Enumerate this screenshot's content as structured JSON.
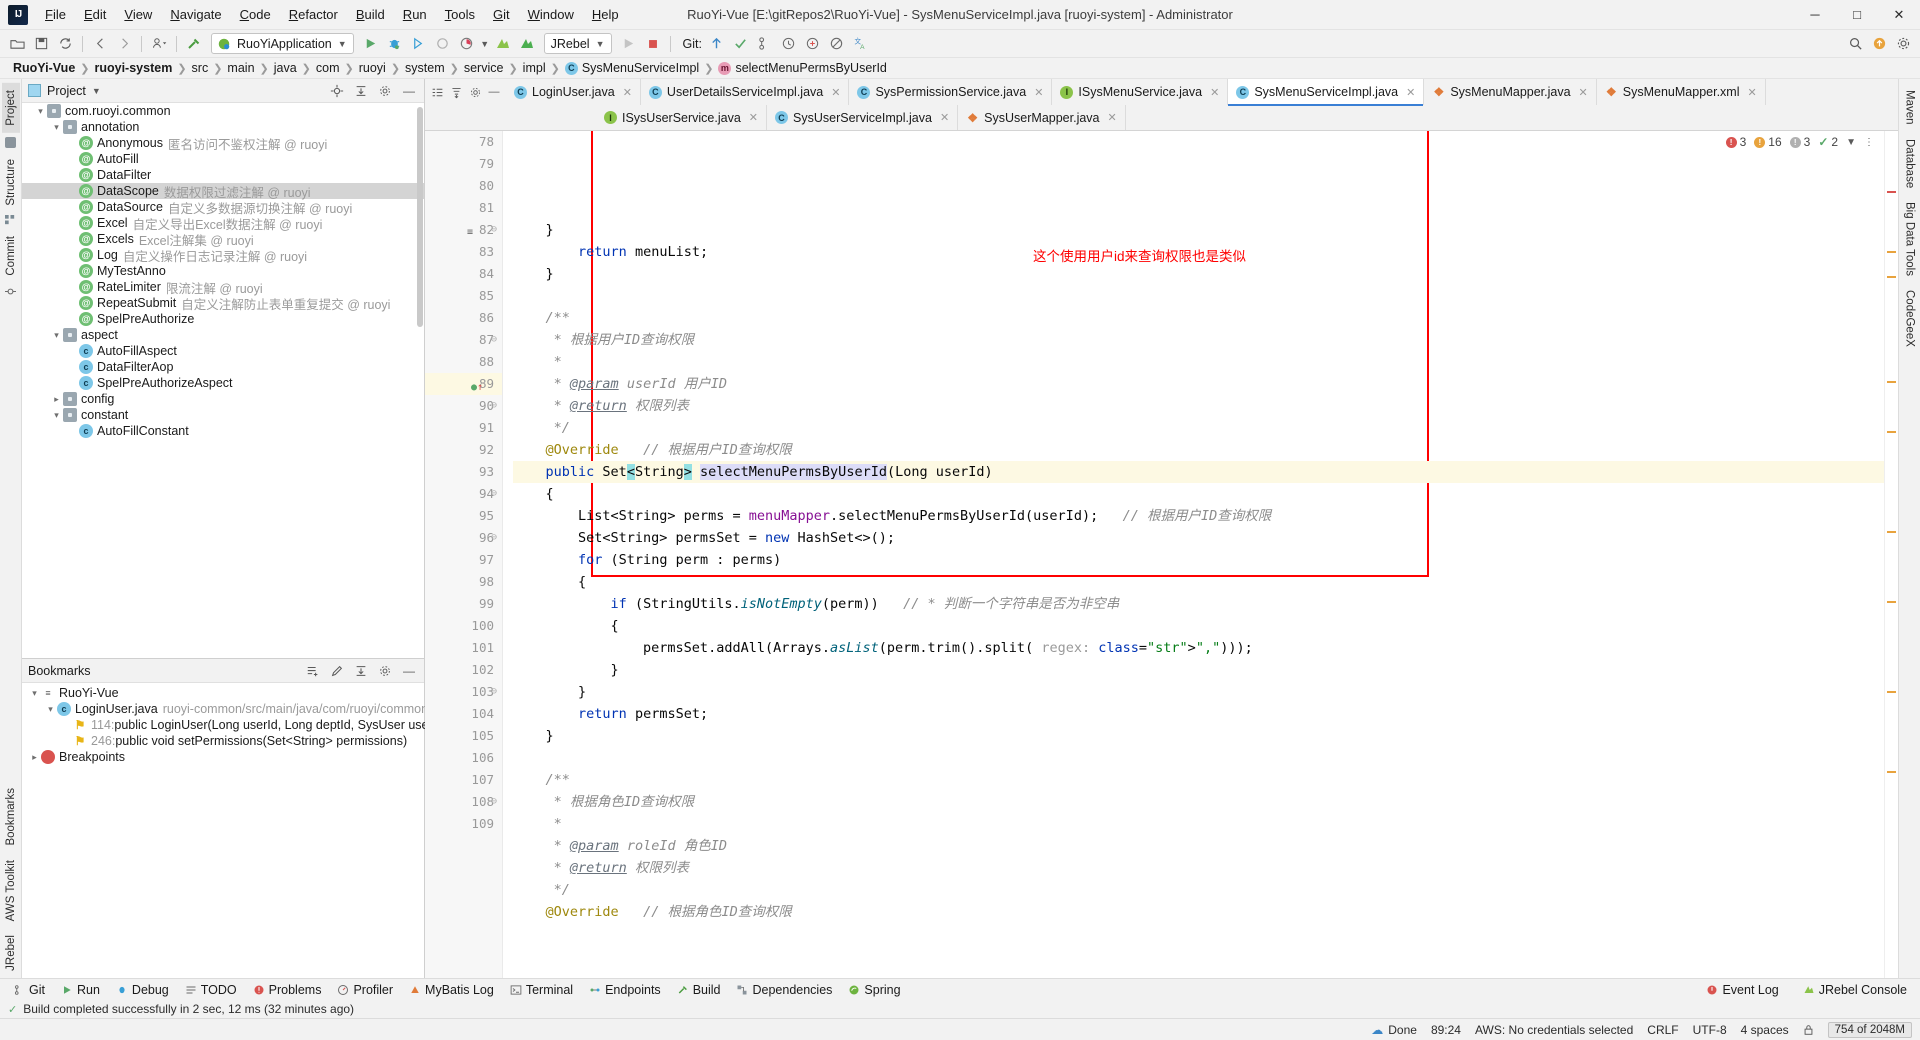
{
  "titlebar": {
    "logo": "IJ",
    "menus": [
      "File",
      "Edit",
      "View",
      "Navigate",
      "Code",
      "Refactor",
      "Build",
      "Run",
      "Tools",
      "Git",
      "Window",
      "Help"
    ],
    "title": "RuoYi-Vue [E:\\gitRepos2\\RuoYi-Vue] - SysMenuServiceImpl.java [ruoyi-system] - Administrator",
    "minimize": "─",
    "maximize": "□",
    "close": "✕"
  },
  "toolbar": {
    "run_config": "RuoYiApplication",
    "jrebel": "JRebel",
    "git_label": "Git:",
    "icons": [
      "open-icon",
      "save-icon",
      "sync-icon",
      "back-icon",
      "forward-icon",
      "profile-icon",
      "build-icon",
      "run-icon",
      "debug-icon",
      "run-coverage-icon",
      "stop-icon",
      "rebel-run-icon",
      "rebel-debug-icon",
      "update-project-icon",
      "commit-icon",
      "search-icon",
      "settings-icon",
      "translate-icon"
    ]
  },
  "breadcrumb": [
    {
      "label": "RuoYi-Vue",
      "bold": true,
      "icon": ""
    },
    {
      "label": "ruoyi-system",
      "bold": true,
      "icon": ""
    },
    {
      "label": "src",
      "bold": false,
      "icon": ""
    },
    {
      "label": "main",
      "bold": false,
      "icon": ""
    },
    {
      "label": "java",
      "bold": false,
      "icon": ""
    },
    {
      "label": "com",
      "bold": false,
      "icon": ""
    },
    {
      "label": "ruoyi",
      "bold": false,
      "icon": ""
    },
    {
      "label": "system",
      "bold": false,
      "icon": ""
    },
    {
      "label": "service",
      "bold": false,
      "icon": ""
    },
    {
      "label": "impl",
      "bold": false,
      "icon": ""
    },
    {
      "label": "SysMenuServiceImpl",
      "bold": false,
      "icon": "C"
    },
    {
      "label": "selectMenuPermsByUserId",
      "bold": false,
      "icon": "m"
    }
  ],
  "rail_left": {
    "top": [
      "Project",
      "Structure",
      "Commit"
    ],
    "bottom": [
      "Bookmarks",
      "AWS Toolkit",
      "JRebel"
    ]
  },
  "rail_right": {
    "top": [
      "Maven",
      "Database",
      "Big Data Tools",
      "CodeGeeX"
    ]
  },
  "project_panel": {
    "title": "Project",
    "tree": [
      {
        "depth": 4,
        "arrow": "v",
        "icon": "folder",
        "name": "com.ruoyi.common",
        "desc": "",
        "selected": false
      },
      {
        "depth": 5,
        "arrow": "v",
        "icon": "folder",
        "name": "annotation",
        "desc": "",
        "selected": false
      },
      {
        "depth": 6,
        "arrow": "",
        "icon": "anno",
        "name": "Anonymous",
        "desc": "匿名访问不鉴权注解  @ ruoyi",
        "selected": false
      },
      {
        "depth": 6,
        "arrow": "",
        "icon": "anno",
        "name": "AutoFill",
        "desc": "",
        "selected": false
      },
      {
        "depth": 6,
        "arrow": "",
        "icon": "anno",
        "name": "DataFilter",
        "desc": "",
        "selected": false
      },
      {
        "depth": 6,
        "arrow": "",
        "icon": "anno",
        "name": "DataScope",
        "desc": "数据权限过滤注解  @ ruoyi",
        "selected": true
      },
      {
        "depth": 6,
        "arrow": "",
        "icon": "anno",
        "name": "DataSource",
        "desc": "自定义多数据源切换注解  @ ruoyi",
        "selected": false
      },
      {
        "depth": 6,
        "arrow": "",
        "icon": "anno",
        "name": "Excel",
        "desc": "自定义导出Excel数据注解  @ ruoyi",
        "selected": false
      },
      {
        "depth": 6,
        "arrow": "",
        "icon": "anno",
        "name": "Excels",
        "desc": "Excel注解集  @ ruoyi",
        "selected": false
      },
      {
        "depth": 6,
        "arrow": "",
        "icon": "anno",
        "name": "Log",
        "desc": "自定义操作日志记录注解  @ ruoyi",
        "selected": false
      },
      {
        "depth": 6,
        "arrow": "",
        "icon": "anno",
        "name": "MyTestAnno",
        "desc": "",
        "selected": false
      },
      {
        "depth": 6,
        "arrow": "",
        "icon": "anno",
        "name": "RateLimiter",
        "desc": "限流注解  @ ruoyi",
        "selected": false
      },
      {
        "depth": 6,
        "arrow": "",
        "icon": "anno",
        "name": "RepeatSubmit",
        "desc": "自定义注解防止表单重复提交  @ ruoyi",
        "selected": false
      },
      {
        "depth": 6,
        "arrow": "",
        "icon": "anno",
        "name": "SpelPreAuthorize",
        "desc": "",
        "selected": false
      },
      {
        "depth": 5,
        "arrow": "v",
        "icon": "folder",
        "name": "aspect",
        "desc": "",
        "selected": false
      },
      {
        "depth": 6,
        "arrow": "",
        "icon": "cls",
        "name": "AutoFillAspect",
        "desc": "",
        "selected": false
      },
      {
        "depth": 6,
        "arrow": "",
        "icon": "cls",
        "name": "DataFilterAop",
        "desc": "",
        "selected": false
      },
      {
        "depth": 6,
        "arrow": "",
        "icon": "cls",
        "name": "SpelPreAuthorizeAspect",
        "desc": "",
        "selected": false
      },
      {
        "depth": 5,
        "arrow": ">",
        "icon": "folder",
        "name": "config",
        "desc": "",
        "selected": false
      },
      {
        "depth": 5,
        "arrow": "v",
        "icon": "folder",
        "name": "constant",
        "desc": "",
        "selected": false
      },
      {
        "depth": 6,
        "arrow": "",
        "icon": "cls",
        "name": "AutoFillConstant",
        "desc": "",
        "selected": false
      }
    ]
  },
  "bookmarks_panel": {
    "title": "Bookmarks",
    "tree": [
      {
        "depth": 0,
        "arrow": "v",
        "icon": "list",
        "name": "RuoYi-Vue",
        "desc": "",
        "line": ""
      },
      {
        "depth": 1,
        "arrow": "v",
        "icon": "cls",
        "name": "LoginUser.java",
        "desc": "ruoyi-common/src/main/java/com/ruoyi/common/core/do",
        "line": ""
      },
      {
        "depth": 2,
        "arrow": "",
        "icon": "bookmark",
        "name": "public LoginUser(Long userId, Long deptId, SysUser user, Set<Stri",
        "desc": "",
        "line": "114:"
      },
      {
        "depth": 2,
        "arrow": "",
        "icon": "bookmark",
        "name": "public void setPermissions(Set<String> permissions)",
        "desc": "",
        "line": "246:"
      },
      {
        "depth": 0,
        "arrow": ">",
        "icon": "breakpoint",
        "name": "Breakpoints",
        "desc": "",
        "line": ""
      }
    ]
  },
  "editor": {
    "tabs_row1": [
      {
        "label": "LoginUser.java",
        "icon": "C",
        "active": false
      },
      {
        "label": "UserDetailsServiceImpl.java",
        "icon": "C",
        "active": false
      },
      {
        "label": "SysPermissionService.java",
        "icon": "C",
        "active": false
      },
      {
        "label": "ISysMenuService.java",
        "icon": "I",
        "active": false
      },
      {
        "label": "SysMenuServiceImpl.java",
        "icon": "C",
        "active": true
      },
      {
        "label": "SysMenuMapper.java",
        "icon": "X",
        "active": false
      },
      {
        "label": "SysMenuMapper.xml",
        "icon": "X",
        "active": false
      }
    ],
    "tabs_row2": [
      {
        "label": "ISysUserService.java",
        "icon": "I",
        "active": false
      },
      {
        "label": "SysUserServiceImpl.java",
        "icon": "C",
        "active": false
      },
      {
        "label": "SysUserMapper.java",
        "icon": "X",
        "active": false
      }
    ],
    "inspection": {
      "errors": "3",
      "warnings": "16",
      "weak_warnings": "3",
      "checks": "2"
    },
    "annotation_text": "这个使用用户id来查询权限也是类似",
    "first_line_number": 78,
    "current_line": 89,
    "lines": [
      {
        "n": 78,
        "text": "    }"
      },
      {
        "n": 79,
        "text": "        return menuList;"
      },
      {
        "n": 80,
        "text": "    }"
      },
      {
        "n": 81,
        "text": ""
      },
      {
        "n": 82,
        "text": "    /**"
      },
      {
        "n": 83,
        "text": "     * 根据用户ID查询权限"
      },
      {
        "n": 84,
        "text": "     *"
      },
      {
        "n": 85,
        "text": "     * @param userId 用户ID"
      },
      {
        "n": 86,
        "text": "     * @return 权限列表"
      },
      {
        "n": 87,
        "text": "     */"
      },
      {
        "n": 88,
        "text": "    @Override   // 根据用户ID查询权限"
      },
      {
        "n": 89,
        "text": "    public Set<String> selectMenuPermsByUserId(Long userId)"
      },
      {
        "n": 90,
        "text": "    {"
      },
      {
        "n": 91,
        "text": "        List<String> perms = menuMapper.selectMenuPermsByUserId(userId);   // 根据用户ID查询权限"
      },
      {
        "n": 92,
        "text": "        Set<String> permsSet = new HashSet<>();"
      },
      {
        "n": 93,
        "text": "        for (String perm : perms)"
      },
      {
        "n": 94,
        "text": "        {"
      },
      {
        "n": 95,
        "text": "            if (StringUtils.isNotEmpty(perm))   // * 判断一个字符串是否为非空串"
      },
      {
        "n": 96,
        "text": "            {"
      },
      {
        "n": 97,
        "text": "                permsSet.addAll(Arrays.asList(perm.trim().split( regex: \",\")));"
      },
      {
        "n": 98,
        "text": "            }"
      },
      {
        "n": 99,
        "text": "        }"
      },
      {
        "n": 100,
        "text": "        return permsSet;"
      },
      {
        "n": 101,
        "text": "    }"
      },
      {
        "n": 102,
        "text": ""
      },
      {
        "n": 103,
        "text": "    /**"
      },
      {
        "n": 104,
        "text": "     * 根据角色ID查询权限"
      },
      {
        "n": 105,
        "text": "     *"
      },
      {
        "n": 106,
        "text": "     * @param roleId 角色ID"
      },
      {
        "n": 107,
        "text": "     * @return 权限列表"
      },
      {
        "n": 108,
        "text": "     */"
      },
      {
        "n": 109,
        "text": "    @Override   // 根据角色ID查询权限"
      }
    ]
  },
  "toolwindow_bar": {
    "items": [
      {
        "label": "Git",
        "icon": "git-icon"
      },
      {
        "label": "Run",
        "icon": "run-icon"
      },
      {
        "label": "Debug",
        "icon": "debug-icon"
      },
      {
        "label": "TODO",
        "icon": "todo-icon"
      },
      {
        "label": "Problems",
        "icon": "problems-icon"
      },
      {
        "label": "Profiler",
        "icon": "profiler-icon"
      },
      {
        "label": "MyBatis Log",
        "icon": "mybatis-icon"
      },
      {
        "label": "Terminal",
        "icon": "terminal-icon"
      },
      {
        "label": "Endpoints",
        "icon": "endpoints-icon"
      },
      {
        "label": "Build",
        "icon": "build-icon"
      },
      {
        "label": "Dependencies",
        "icon": "dependencies-icon"
      },
      {
        "label": "Spring",
        "icon": "spring-icon"
      }
    ],
    "right": [
      {
        "label": "Event Log",
        "icon": "event-log-icon"
      },
      {
        "label": "JRebel Console",
        "icon": "jrebel-icon"
      }
    ]
  },
  "statusbar": {
    "build_message": "Build completed successfully in 2 sec, 12 ms (32 minutes ago)",
    "done": "Done",
    "time": "89:24",
    "aws": "AWS: No credentials selected",
    "line_sep": "CRLF",
    "encoding": "UTF-8",
    "indent": "4 spaces",
    "memory": "754 of 2048M",
    "caret_position": ""
  }
}
